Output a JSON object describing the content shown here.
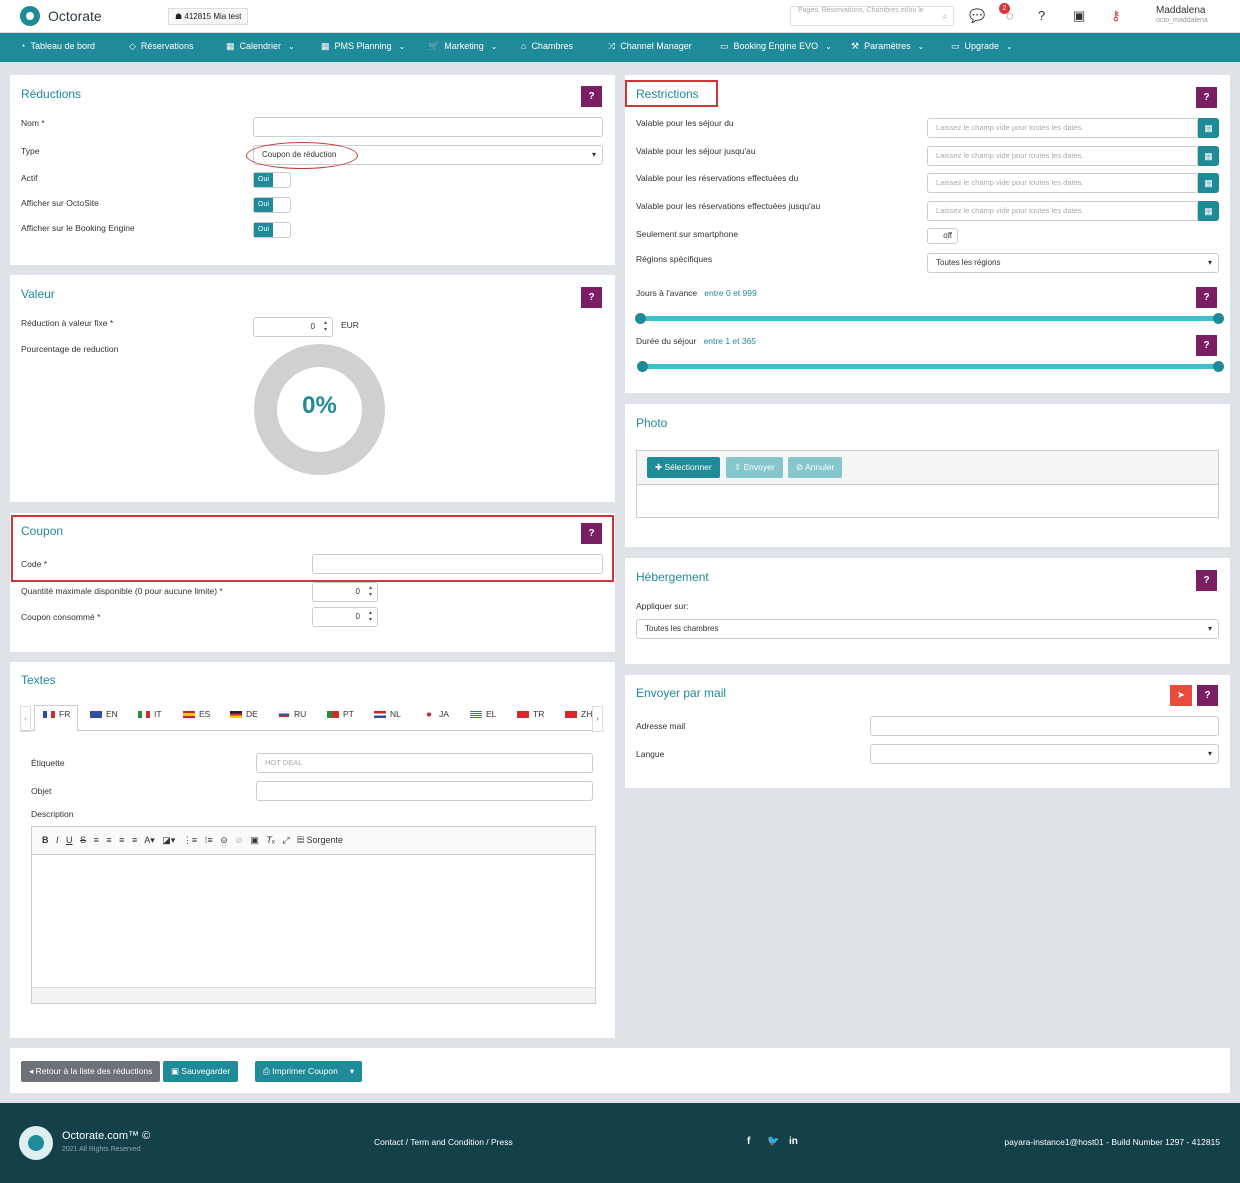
{
  "top": {
    "brand": "Octorate",
    "property": "☗ 412815  Mia test",
    "search_placeholder": "Pages, Réservations, Chambres et/ou le",
    "notification_count": "2",
    "user_name": "Maddalena",
    "user_login": "octo_maddalena"
  },
  "nav": [
    "Tableau de bord",
    "Réservations",
    "Calendrier",
    "PMS Planning",
    "Marketing",
    "Chambres",
    "Channel Manager",
    "Booking Engine EVO",
    "Paramètres",
    "Upgrade"
  ],
  "reductions": {
    "title": "Réductions",
    "name_label": "Nom *",
    "type_label": "Type",
    "type_value": "Coupon de réduction",
    "active_label": "Actif",
    "octosite_label": "Afficher sur OctoSite",
    "booking_label": "Afficher sur le Booking Engine",
    "toggle_on": "Oui"
  },
  "valeur": {
    "title": "Valeur",
    "fixed_label": "Réduction à valeur fixe *",
    "fixed_value": "0",
    "currency": "EUR",
    "percent_label": "Pourcentage de reduction",
    "percent_display": "0%",
    "percent_value": 0
  },
  "coupon": {
    "title": "Coupon",
    "code_label": "Code *",
    "qty_label": "Quantité maximale disponible (0 pour aucune limite) *",
    "qty_value": "0",
    "consumed_label": "Coupon consommé *",
    "consumed_value": "0"
  },
  "textes": {
    "title": "Textes",
    "languages": [
      "FR",
      "EN",
      "IT",
      "ES",
      "DE",
      "RU",
      "PT",
      "NL",
      "JA",
      "EL",
      "TR",
      "ZH"
    ],
    "label_label": "Étiquette",
    "label_placeholder": "HOT DEAL",
    "object_label": "Objet",
    "description_label": "Description",
    "source_button": "Sorgente"
  },
  "restrictions": {
    "title": "Restrictions",
    "stay_from_label": "Valable pour les séjour du",
    "stay_to_label": "Valable pour les séjour jusqu'au",
    "booking_from_label": "Valable pour les réservations effectuées du",
    "booking_to_label": "Valable pour les réservations effectuées jusqu'au",
    "date_placeholder": "Laissez le champ vide pour toutes les dates.",
    "smartphone_label": "Seulement sur smartphone",
    "smartphone_value": "off",
    "regions_label": "Régions spécifiques",
    "regions_value": "Toutes les régions",
    "advance_label": "Jours à l'avance",
    "advance_range": "entre 0 et 999",
    "advance_min": 0,
    "advance_max": 999,
    "stay_label": "Durée du séjour",
    "stay_range": "entre 1 et 365",
    "stay_min": 1,
    "stay_max": 365
  },
  "photo": {
    "title": "Photo",
    "select": "Sélectionner",
    "send": "Envoyer",
    "cancel": "Annuler"
  },
  "hebergement": {
    "title": "Hébergement",
    "apply_label": "Appliquer sur:",
    "apply_value": "Toutes les chambres"
  },
  "mail": {
    "title": "Envoyer par mail",
    "address_label": "Adresse mail",
    "language_label": "Langue"
  },
  "actions": {
    "back": "Retour à la liste des réductions",
    "save": "Sauvegarder",
    "print": "Imprimer Coupon"
  },
  "footer": {
    "brand": "Octorate.com™ ©",
    "rights": "2021 All Rights Reserved",
    "links": "Contact / Term and Condition / Press",
    "build": "payara-instance1@host01 - Build Number 1297 - 412815"
  },
  "colors": {
    "primary": "#1f8a98",
    "help": "#7a1f63",
    "annotation": "#d23535"
  }
}
